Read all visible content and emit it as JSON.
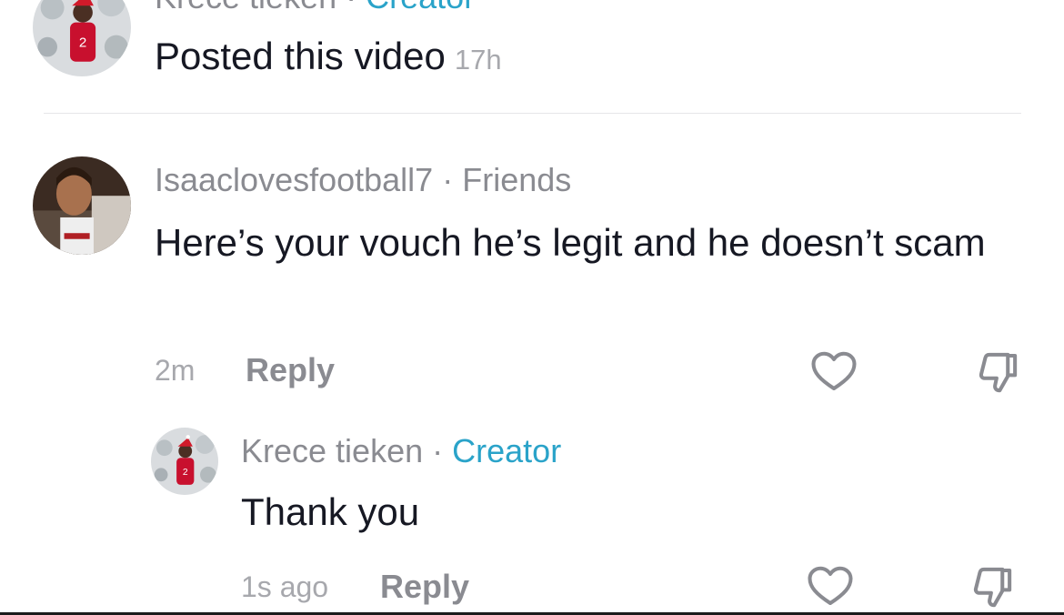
{
  "top_comment": {
    "username": "Krece tieken",
    "separator": "·",
    "badge": "Creator",
    "text": "Posted this video",
    "time": "17h"
  },
  "comment": {
    "username": "Isaaclovesfootball7",
    "separator": "·",
    "relation": "Friends",
    "text": "Here’s your vouch he’s legit and he doesn’t scam",
    "time": "2m",
    "reply_label": "Reply"
  },
  "reply": {
    "username": "Krece tieken",
    "separator": "·",
    "badge": "Creator",
    "text": "Thank you",
    "time": "1s ago",
    "reply_label": "Reply"
  },
  "colors": {
    "creator_accent": "#2aa3c9",
    "muted_text": "#8a8b91",
    "primary_text": "#161823"
  },
  "icons": {
    "like": "heart-outline-icon",
    "dislike": "thumbs-down-outline-icon"
  }
}
